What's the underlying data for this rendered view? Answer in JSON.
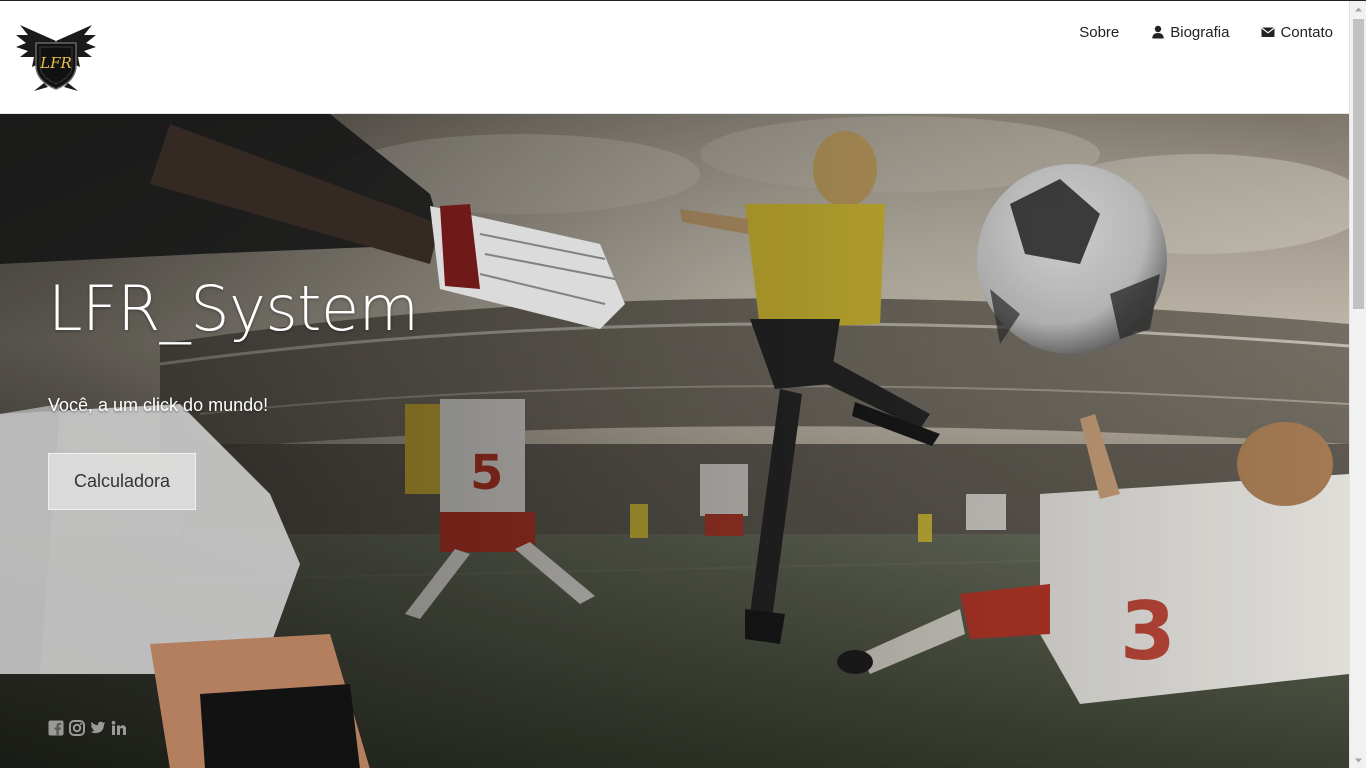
{
  "header": {
    "logo_text": "LFR",
    "nav": [
      {
        "label": "Sobre",
        "icon": "none"
      },
      {
        "label": "Biografia",
        "icon": "user-icon"
      },
      {
        "label": "Contato",
        "icon": "envelope-icon"
      }
    ]
  },
  "hero": {
    "title": "LFR_System",
    "subtitle": "Você, a um click do mundo!",
    "button_label": "Calculadora",
    "social": [
      "facebook-icon",
      "instagram-icon",
      "twitter-icon",
      "linkedin-icon"
    ]
  },
  "colors": {
    "header_bg": "#ffffff",
    "nav_text": "#222222",
    "hero_text": "#ffffff",
    "button_bg": "#dedede",
    "social_icon": "#9a9a9a",
    "player_yellow": "#e8cf3a",
    "team_red": "#c23a2a"
  }
}
